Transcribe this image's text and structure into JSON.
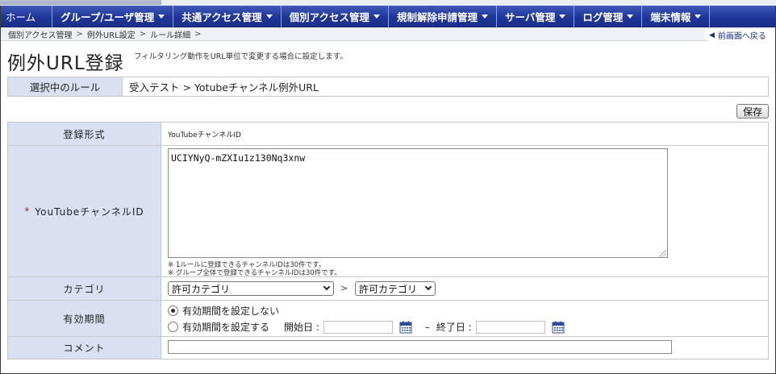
{
  "nav": {
    "items": [
      {
        "label": "ホーム",
        "has_caret": false
      },
      {
        "label": "グループ/ユーザ管理",
        "has_caret": true
      },
      {
        "label": "共通アクセス管理",
        "has_caret": true
      },
      {
        "label": "個別アクセス管理",
        "has_caret": true
      },
      {
        "label": "規制解除申請管理",
        "has_caret": true
      },
      {
        "label": "サーバ管理",
        "has_caret": true
      },
      {
        "label": "ログ管理",
        "has_caret": true
      },
      {
        "label": "端末情報",
        "has_caret": true
      }
    ]
  },
  "breadcrumb": {
    "items": [
      "個別アクセス管理",
      "例外URL設定",
      "ルール詳細"
    ],
    "separator": ">",
    "back_label": "前画面へ戻る"
  },
  "page": {
    "title": "例外URL登録",
    "subtitle": "フィルタリング動作をURL単位で変更する場合に設定します。"
  },
  "selected_rule": {
    "label": "選択中のルール",
    "value": "受入テスト > Yotubeチャンネル例外URL"
  },
  "toolbar": {
    "save_label": "保存"
  },
  "form": {
    "format": {
      "label": "登録形式",
      "value": "YouTubeチャンネルID"
    },
    "channel": {
      "required_mark": "*",
      "label": "YouTubeチャンネルID",
      "value": "UCIYNyQ-mZXIu1z130Nq3xnw",
      "note1": "※ 1ルールに登録できるチャンネルIDは30件です。",
      "note2": "※ グループ全体で登録できるチャンネルIDは30件です。"
    },
    "category": {
      "label": "カテゴリ",
      "select1": "許可カテゴリ",
      "separator": ">",
      "select2": "許可カテゴリ"
    },
    "period": {
      "label": "有効期間",
      "option_none": "有効期間を設定しない",
      "option_set": "有効期間を設定する",
      "selected": "option_none",
      "start_label": "開始日 :",
      "dash": "–",
      "end_label": "終了日 :",
      "start_value": "",
      "end_value": ""
    },
    "comment": {
      "label": "コメント",
      "value": ""
    }
  },
  "colors": {
    "nav_bg": "#1f3699",
    "label_bg": "#dadff2",
    "required": "#d4122b"
  },
  "icons": [
    "caret-down-icon",
    "calendar-icon",
    "chevron-left-icon"
  ]
}
